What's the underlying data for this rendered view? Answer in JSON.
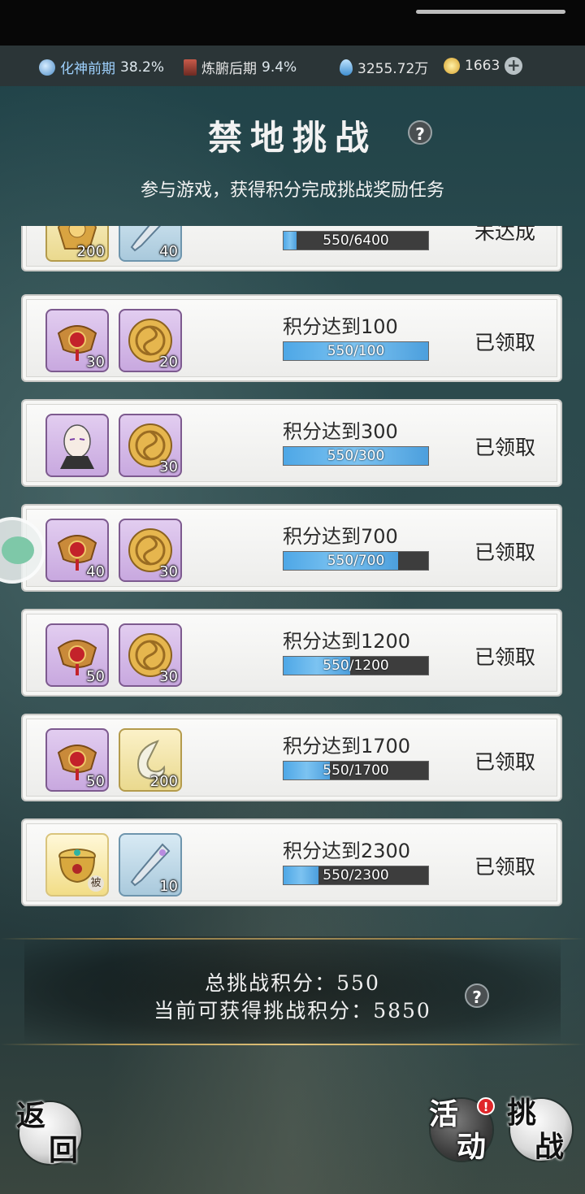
{
  "resources": {
    "realm1_name": "化神前期",
    "realm1_pct": "38.2%",
    "realm2_name": "炼腑后期",
    "realm2_pct": "9.4%",
    "spirit_stones": "3255.72万",
    "gold": "1663"
  },
  "header": {
    "title": "禁地挑战",
    "subtitle": "参与游戏，获得积分完成挑战奖励任务"
  },
  "tasks": [
    {
      "goal": "",
      "progress": "550/6400",
      "fraction": 0.086,
      "status": "未达成",
      "rewards": [
        {
          "icon": "golden-token-icon",
          "count": "200"
        },
        {
          "icon": "spirit-sword-icon",
          "count": "40"
        }
      ]
    },
    {
      "goal": "积分达到100",
      "progress": "550/100",
      "fraction": 1.0,
      "status": "已领取",
      "rewards": [
        {
          "icon": "red-ornament-icon",
          "count": "30"
        },
        {
          "icon": "gold-coin-icon",
          "count": "20"
        }
      ]
    },
    {
      "goal": "积分达到300",
      "progress": "550/300",
      "fraction": 1.0,
      "status": "已领取",
      "rewards": [
        {
          "icon": "character-portrait-icon",
          "count": ""
        },
        {
          "icon": "gold-coin-icon",
          "count": "30"
        }
      ]
    },
    {
      "goal": "积分达到700",
      "progress": "550/700",
      "fraction": 0.786,
      "status": "已领取",
      "rewards": [
        {
          "icon": "red-ornament-icon",
          "count": "40"
        },
        {
          "icon": "gold-coin-icon",
          "count": "30"
        }
      ]
    },
    {
      "goal": "积分达到1200",
      "progress": "550/1200",
      "fraction": 0.458,
      "status": "已领取",
      "rewards": [
        {
          "icon": "red-ornament-icon",
          "count": "50"
        },
        {
          "icon": "gold-coin-icon",
          "count": "30"
        }
      ]
    },
    {
      "goal": "积分达到1700",
      "progress": "550/1700",
      "fraction": 0.324,
      "status": "已领取",
      "rewards": [
        {
          "icon": "red-ornament-icon",
          "count": "50"
        },
        {
          "icon": "jade-crescent-icon",
          "count": "200"
        }
      ]
    },
    {
      "goal": "积分达到2300",
      "progress": "550/2300",
      "fraction": 0.239,
      "status": "已领取",
      "rewards": [
        {
          "icon": "treasure-cauldron-icon",
          "count": "",
          "tag": "被"
        },
        {
          "icon": "spirit-sword-icon",
          "count": "10"
        }
      ]
    }
  ],
  "summary": {
    "total_label": "总挑战积分：",
    "total_value": "550",
    "available_label": "当前可获得挑战积分：",
    "available_value": "5850"
  },
  "buttons": {
    "back": [
      "返",
      "回"
    ],
    "activity": [
      "活",
      "动"
    ],
    "challenge": [
      "挑",
      "战"
    ],
    "activity_badge": "!"
  },
  "help_glyph": "?"
}
